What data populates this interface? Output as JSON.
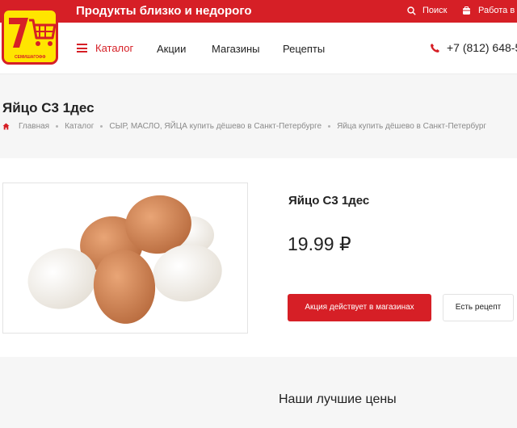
{
  "header": {
    "tagline": "Продукты близко и недорого",
    "search_label": "Поиск",
    "work_label": "Работа в к",
    "logo_digit": "7",
    "logo_caption": "СЕМИШАГОФФ"
  },
  "nav": {
    "catalog_label": "Каталог",
    "items": [
      "Акции",
      "Магазины",
      "Рецепты"
    ],
    "phone": "+7 (812) 648-5"
  },
  "page": {
    "title": "Яйцо С3 1дес",
    "breadcrumb": [
      "Главная",
      "Каталог",
      "СЫР, МАСЛО, ЯЙЦА купить дёшево в Санкт-Петербурге",
      "Яйца купить дёшево в Санкт-Петербург"
    ]
  },
  "product": {
    "name": "Яйцо С3 1дес",
    "price": "19.99 ₽",
    "promo_button": "Акция действует в магазинах",
    "recipe_button": "Есть рецепт"
  },
  "best_prices": {
    "heading": "Наши лучшие цены"
  },
  "colors": {
    "brand_red": "#d61f26",
    "logo_yellow": "#ffe500"
  },
  "icons": [
    "search-icon",
    "shield-icon",
    "menu-icon",
    "phone-icon",
    "home-icon",
    "cart-icon"
  ]
}
